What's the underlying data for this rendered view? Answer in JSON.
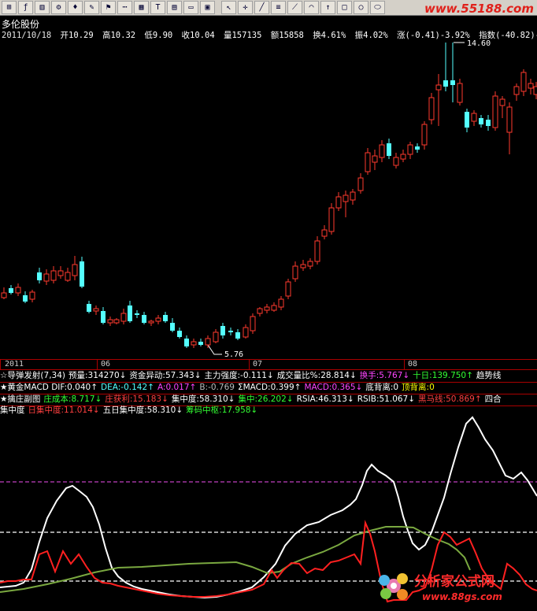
{
  "window": {
    "watermark_site": "www.55188.com",
    "watermark_bottom_title": "分析家公式网",
    "watermark_bottom_url": "www.88gs.com"
  },
  "toolbar": {
    "icons": [
      "data-icon",
      "formula-icon",
      "chart-icon",
      "settings-icon",
      "alarm-icon",
      "pen-icon",
      "flag-icon",
      "dots-icon",
      "grid-icon",
      "text-icon",
      "bars-icon",
      "window-icon",
      "image-icon",
      "cursor-icon",
      "cross-icon",
      "line-icon",
      "multiline-icon",
      "fan-icon",
      "arc-icon",
      "up-arrow-icon",
      "rect-icon",
      "circle-icon",
      "ellipse-icon"
    ]
  },
  "stock": {
    "name": "多伦股份"
  },
  "quote": {
    "date": "2011/10/18",
    "open": "开10.29",
    "high": "高10.32",
    "low": "低9.90",
    "close": "收10.04",
    "volume": "量157135",
    "amount": "额15858",
    "turnover": "换4.61%",
    "amplitude": "振4.02%",
    "change": "涨(-0.41)-3.92%",
    "index": "指数(-40.82)-1.67"
  },
  "price_panel": {
    "max_label": "14.60",
    "min_label": "5.76",
    "colors": {
      "up": "#ff3a2e",
      "down": "#54ffff"
    }
  },
  "time_axis": {
    "labels": [
      "2011",
      "06",
      "07",
      "08"
    ]
  },
  "indicator_rows": [
    {
      "id": "r1",
      "parts": [
        {
          "t": "☆导弹发射(7,34)",
          "c": "white"
        },
        {
          "t": "预量:314270↓",
          "c": "white"
        },
        {
          "t": "资金异动:57.343↓",
          "c": "white"
        },
        {
          "t": "主力强度:-0.111↓",
          "c": "white"
        },
        {
          "t": "成交量比%:28.814↓",
          "c": "white"
        },
        {
          "t": "换手:5.767↓",
          "c": "magenta"
        },
        {
          "t": "十日:139.750↑",
          "c": "green"
        },
        {
          "t": "趋势线",
          "c": "white"
        }
      ]
    },
    {
      "id": "r2",
      "parts": [
        {
          "t": "★黄金MACD DIF:0.040↑",
          "c": "white"
        },
        {
          "t": "DEA:-0.142↑",
          "c": "cyan"
        },
        {
          "t": "A:0.017↑",
          "c": "magenta"
        },
        {
          "t": "B:-0.769",
          "c": "gray"
        },
        {
          "t": "ΣMACD:0.399↑",
          "c": "white"
        },
        {
          "t": "MACD:0.365↓",
          "c": "magenta"
        },
        {
          "t": "底背离:0",
          "c": "white"
        },
        {
          "t": "顶背离:0",
          "c": "yellow"
        }
      ]
    },
    {
      "id": "r3",
      "parts": [
        {
          "t": "★擒庄副图",
          "c": "white"
        },
        {
          "t": "庄成本:8.717↓",
          "c": "green"
        },
        {
          "t": "庄获利:15.183↓",
          "c": "red"
        },
        {
          "t": "集中度:58.310↓",
          "c": "white"
        },
        {
          "t": "集中:26.202↓",
          "c": "green"
        },
        {
          "t": "RSIA:46.313↓",
          "c": "white"
        },
        {
          "t": "RSIB:51.067↓",
          "c": "white"
        },
        {
          "t": "黑马线:50.869↑",
          "c": "red"
        },
        {
          "t": "四合",
          "c": "white"
        }
      ]
    },
    {
      "id": "r4",
      "parts": [
        {
          "t": "集中度",
          "c": "white"
        },
        {
          "t": "日集中度:11.014↓",
          "c": "red"
        },
        {
          "t": "五日集中度:58.310↓",
          "c": "white"
        },
        {
          "t": "筹码中枢:17.958↓",
          "c": "green"
        }
      ]
    }
  ]
}
